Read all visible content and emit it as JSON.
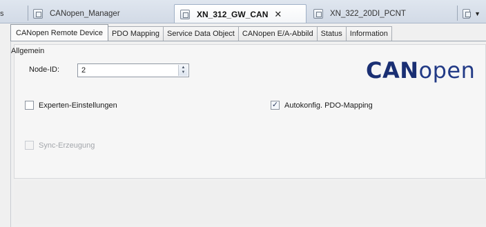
{
  "doc_tabs": [
    {
      "label": "CANopen_Manager",
      "active": false
    },
    {
      "label": "XN_312_GW_CAN",
      "active": true
    },
    {
      "label": "XN_322_20DI_PCNT",
      "active": false
    }
  ],
  "inner_tabs": [
    {
      "label": "CANopen Remote Device",
      "active": true
    },
    {
      "label": "PDO Mapping",
      "active": false
    },
    {
      "label": "Service Data Object",
      "active": false
    },
    {
      "label": "CANopen E/A-Abbild",
      "active": false
    },
    {
      "label": "Status",
      "active": false
    },
    {
      "label": "Information",
      "active": false
    }
  ],
  "general": {
    "group_title": "Allgemein",
    "node_id_label": "Node-ID:",
    "node_id_value": "2"
  },
  "logo": {
    "bold": "CAN",
    "light": "open"
  },
  "options": {
    "expert_settings": {
      "label": "Experten-Einstellungen",
      "checked": false
    },
    "auto_pdo": {
      "label": "Autokonfig. PDO-Mapping",
      "checked": true
    },
    "sync_generation": {
      "label": "Sync-Erzeugung",
      "checked": false,
      "enabled": false
    }
  },
  "colors": {
    "logo": "#1a2f73",
    "accent": "#9fb0c6"
  }
}
